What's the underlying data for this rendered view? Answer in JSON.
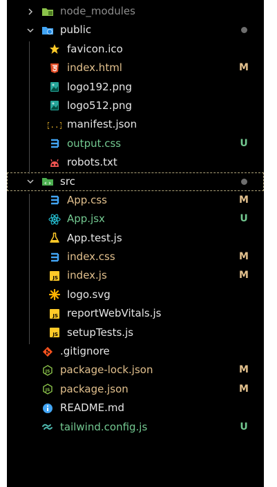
{
  "colors": {
    "modified": "#e2c08d",
    "untracked": "#73c991",
    "text": "#e6e6e6",
    "ignored": "#8d8d8d"
  },
  "tree": {
    "node_modules": {
      "name": "node_modules",
      "expanded": false,
      "icon": "folder-node-icon"
    },
    "public": {
      "name": "public",
      "expanded": true,
      "icon": "folder-public-icon"
    },
    "public_files": [
      {
        "name": "favicon.ico",
        "icon": "star-icon"
      },
      {
        "name": "index.html",
        "icon": "html-icon",
        "status": "M"
      },
      {
        "name": "logo192.png",
        "icon": "image-icon"
      },
      {
        "name": "logo512.png",
        "icon": "image-icon"
      },
      {
        "name": "manifest.json",
        "icon": "json-braces-icon"
      },
      {
        "name": "output.css",
        "icon": "css-icon",
        "status": "U"
      },
      {
        "name": "robots.txt",
        "icon": "robot-icon"
      }
    ],
    "src": {
      "name": "src",
      "expanded": true,
      "icon": "folder-src-icon"
    },
    "src_files": [
      {
        "name": "App.css",
        "icon": "css-icon",
        "status": "M"
      },
      {
        "name": "App.jsx",
        "icon": "react-icon",
        "status": "U"
      },
      {
        "name": "App.test.js",
        "icon": "flask-icon"
      },
      {
        "name": "index.css",
        "icon": "css-icon",
        "status": "M"
      },
      {
        "name": "index.js",
        "icon": "js-icon",
        "status": "M"
      },
      {
        "name": "logo.svg",
        "icon": "svg-icon"
      },
      {
        "name": "reportWebVitals.js",
        "icon": "js-icon"
      },
      {
        "name": "setupTests.js",
        "icon": "js-icon"
      }
    ],
    "root_files": [
      {
        "name": ".gitignore",
        "icon": "git-icon"
      },
      {
        "name": "package-lock.json",
        "icon": "nodejs-icon",
        "status": "M"
      },
      {
        "name": "package.json",
        "icon": "nodejs-icon",
        "status": "M"
      },
      {
        "name": "README.md",
        "icon": "info-icon"
      },
      {
        "name": "tailwind.config.js",
        "icon": "tailwind-icon",
        "status": "U"
      }
    ]
  }
}
